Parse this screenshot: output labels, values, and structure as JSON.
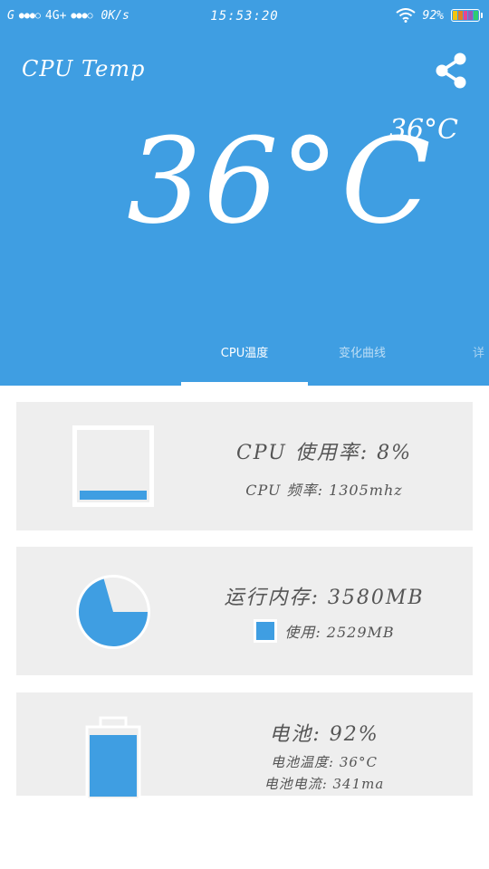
{
  "status_bar": {
    "carrier_g": "G",
    "dots1": "●●●○",
    "network": "4G+",
    "dots2": "●●●○",
    "speed": "0K/s",
    "time": "15:53:20",
    "battery_percent": "92%",
    "battery_colors": [
      "#f1c40f",
      "#e67e22",
      "#e84393",
      "#9b59b6",
      "#2ecc71"
    ]
  },
  "app": {
    "title": "CPU Temp",
    "small_temp": "36°C",
    "big_temp": "36°C",
    "accent_color": "#3f9ee2"
  },
  "tabs": [
    {
      "label": "CPU温度",
      "active": true
    },
    {
      "label": "变化曲线",
      "active": false
    },
    {
      "label": "详",
      "active": false
    }
  ],
  "cards": {
    "cpu": {
      "usage_label": "CPU 使用率: 8%",
      "freq_label": "CPU 频率: 1305mhz",
      "usage_fraction": 0.08
    },
    "memory": {
      "total_label": "运行内存: 3580MB",
      "used_label": "使用: 2529MB",
      "used_fraction": 0.706
    },
    "battery": {
      "level_label": "电池: 92%",
      "temp_label": "电池温度: 36°C",
      "current_label": "电池电流: 341ma",
      "level_fraction": 0.92
    }
  }
}
